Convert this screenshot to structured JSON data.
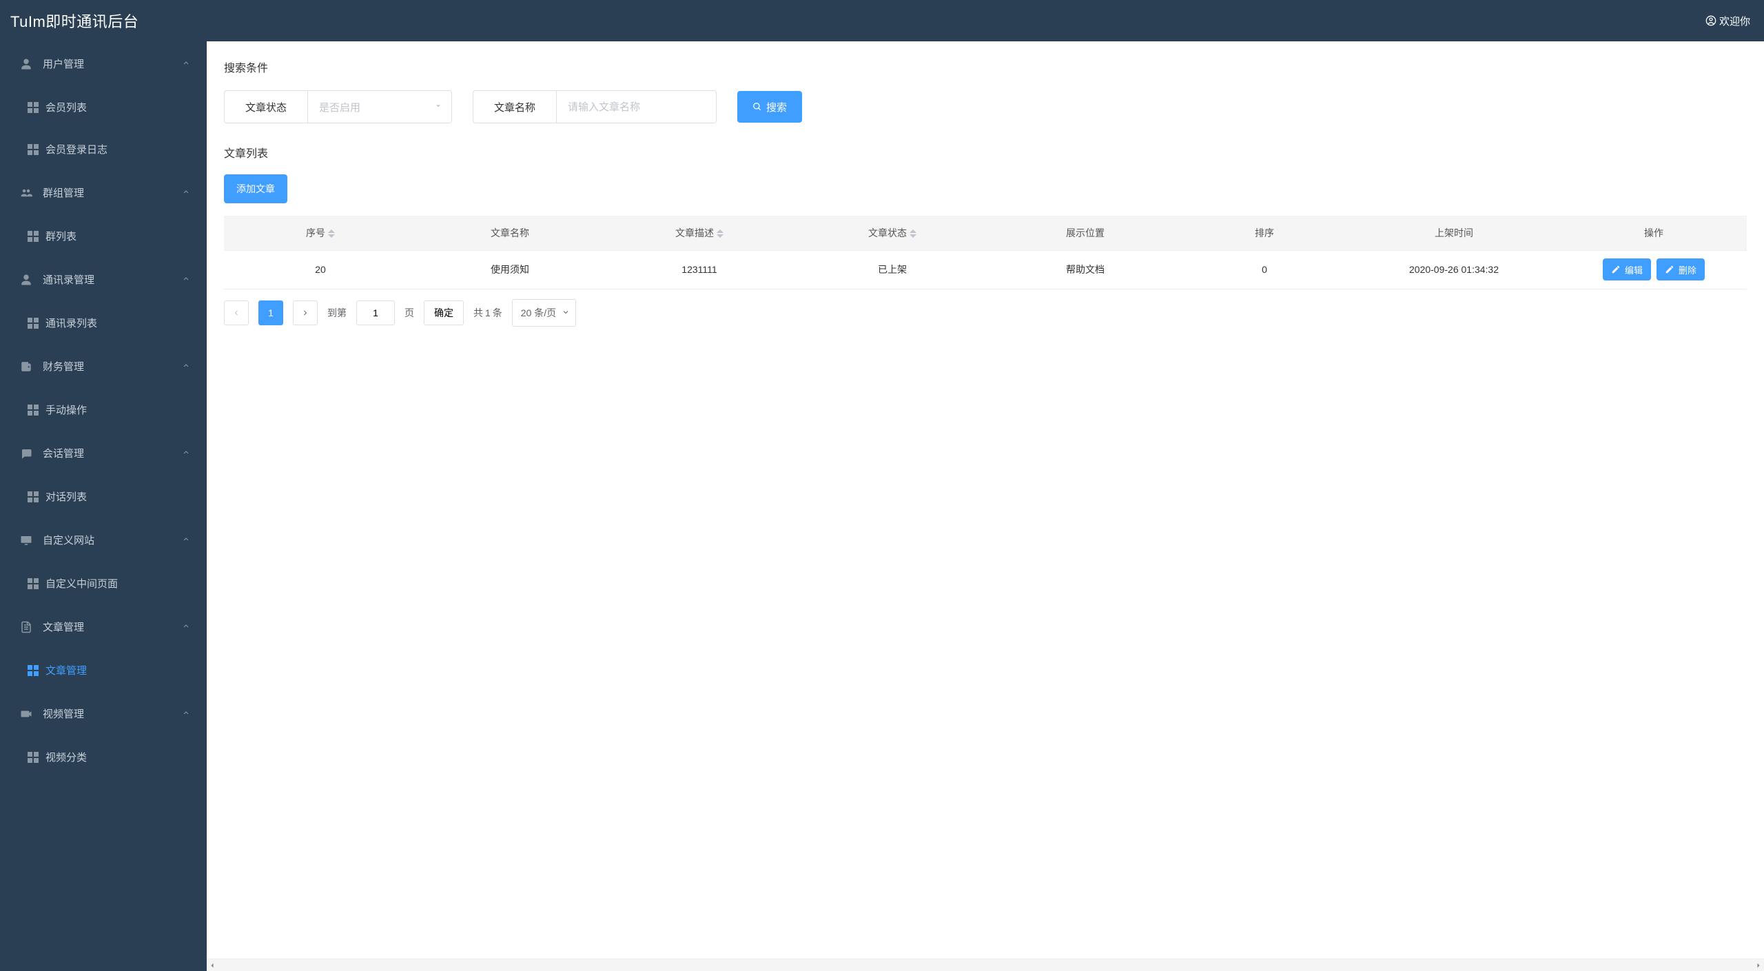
{
  "header": {
    "brand": "TuIm即时通讯后台",
    "welcome": "欢迎你"
  },
  "sidebar": [
    {
      "label": "用户管理",
      "icon": "user",
      "children": [
        {
          "label": "会员列表",
          "active": false
        },
        {
          "label": "会员登录日志",
          "active": false
        }
      ]
    },
    {
      "label": "群组管理",
      "icon": "group",
      "children": [
        {
          "label": "群列表",
          "active": false
        }
      ]
    },
    {
      "label": "通讯录管理",
      "icon": "contacts",
      "children": [
        {
          "label": "通讯录列表",
          "active": false
        }
      ]
    },
    {
      "label": "财务管理",
      "icon": "wallet",
      "children": [
        {
          "label": "手动操作",
          "active": false
        }
      ]
    },
    {
      "label": "会话管理",
      "icon": "chat",
      "children": [
        {
          "label": "对话列表",
          "active": false
        }
      ]
    },
    {
      "label": "自定义网站",
      "icon": "monitor",
      "children": [
        {
          "label": "自定义中间页面",
          "active": false
        }
      ]
    },
    {
      "label": "文章管理",
      "icon": "article",
      "children": [
        {
          "label": "文章管理",
          "active": true
        }
      ]
    },
    {
      "label": "视频管理",
      "icon": "video",
      "children": [
        {
          "label": "视频分类",
          "active": false
        }
      ]
    }
  ],
  "search": {
    "title": "搜索条件",
    "status_label": "文章状态",
    "status_placeholder": "是否启用",
    "name_label": "文章名称",
    "name_placeholder": "请输入文章名称",
    "search_btn": "搜索"
  },
  "list": {
    "title": "文章列表",
    "add_btn": "添加文章",
    "columns": {
      "seq": "序号",
      "name": "文章名称",
      "desc": "文章描述",
      "status": "文章状态",
      "pos": "展示位置",
      "sort": "排序",
      "time": "上架时间",
      "ops": "操作"
    },
    "rows": [
      {
        "seq": "20",
        "name": "使用须知",
        "desc": "1231111",
        "status": "已上架",
        "pos": "帮助文档",
        "sort": "0",
        "time": "2020-09-26 01:34:32"
      }
    ],
    "edit_btn": "编辑",
    "delete_btn": "删除"
  },
  "pagination": {
    "current": "1",
    "goto_label": "到第",
    "page_input": "1",
    "page_label": "页",
    "confirm": "确定",
    "total_prefix": "共",
    "total_n": "1",
    "total_suffix": "条",
    "per_page": "20 条/页"
  }
}
